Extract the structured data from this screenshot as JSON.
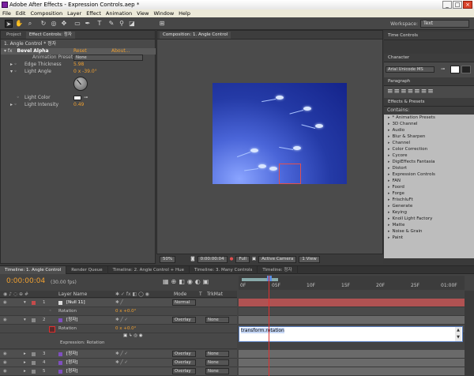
{
  "window": {
    "title": "Adobe After Effects - Expression Controls.aep *",
    "buttons": [
      "_",
      "□",
      "×"
    ]
  },
  "menu": [
    "File",
    "Edit",
    "Composition",
    "Layer",
    "Effect",
    "Animation",
    "View",
    "Window",
    "Help"
  ],
  "workspace": {
    "label": "Workspace:",
    "value": "Text"
  },
  "left_panel": {
    "tabs": [
      "Project",
      "Effect Controls: 정자"
    ],
    "header": "1. Angle Control * 정자",
    "effect": {
      "name": "Bevel Alpha",
      "reset": "Reset",
      "about": "About..."
    },
    "presets_label": "Animation Presets:",
    "presets_value": "None",
    "props": [
      {
        "label": "Edge Thickness",
        "value": "5.98"
      },
      {
        "label": "Light Angle",
        "value": "0 x -39.0°"
      },
      {
        "label": "Light Color",
        "value": ""
      },
      {
        "label": "Light Intensity",
        "value": "0.49"
      }
    ]
  },
  "comp_panel": {
    "tab": "Composition: 1. Angle Control",
    "footer": {
      "zoom": "50%",
      "timecode": "0:00:00:04",
      "resolution": "Full",
      "view": "Active Camera",
      "views": "1 View"
    }
  },
  "right_panels": {
    "time_controls": "Time Controls",
    "character": "Character",
    "font": "Arial Unicode MS",
    "paragraph": "Paragraph",
    "effects_presets": "Effects & Presets",
    "contains_label": "Contains:",
    "categories": [
      "* Animation Presets",
      "3D Channel",
      "Audio",
      "Blur & Sharpen",
      "Channel",
      "Color Correction",
      "Cycore",
      "DigiEffects Fantasia",
      "Distort",
      "Expression Controls",
      "FAN",
      "Foord",
      "Forge",
      "FrischluFt",
      "Generate",
      "Keying",
      "Knoll Light Factory",
      "Matte",
      "Noise & Grain",
      "Paint"
    ]
  },
  "timeline": {
    "tabs": [
      "Timeline: 1. Angle Control",
      "Render Queue",
      "Timeline: 2. Angle Control + Hue",
      "Timeline: 3. Many Controls",
      "Timeline: 정자"
    ],
    "timecode": "0:00:00:04",
    "fps": "(30.00 fps)",
    "headers": {
      "layer_name": "Layer Name",
      "mode": "Mode",
      "t": "T",
      "trkmat": "TrkMat"
    },
    "ruler": [
      "0F",
      "05F",
      "10F",
      "15F",
      "20F",
      "25F",
      "01:00F"
    ],
    "layers": [
      {
        "num": "1",
        "name": "[Null 11]",
        "mode": "Normal",
        "trkmat": "",
        "color": "#c64b4b"
      },
      {
        "num": "",
        "name": "Rotation",
        "value": "0 x +0.0°"
      },
      {
        "num": "2",
        "name": "[정자]",
        "mode": "Overlay",
        "trkmat": "None",
        "color": "#8a8a8a"
      },
      {
        "num": "",
        "name": "Rotation",
        "value": "0 x +0.0°"
      },
      {
        "num": "",
        "name": "Expression: Rotation",
        "value": ""
      },
      {
        "num": "3",
        "name": "[정자]",
        "mode": "Overlay",
        "trkmat": "None",
        "color": "#8a8a8a"
      },
      {
        "num": "4",
        "name": "[정자]",
        "mode": "Overlay",
        "trkmat": "None",
        "color": "#8a8a8a"
      },
      {
        "num": "5",
        "name": "[정자]",
        "mode": "Overlay",
        "trkmat": "None",
        "color": "#8a8a8a"
      }
    ],
    "expression_text": "transform.rotation"
  }
}
